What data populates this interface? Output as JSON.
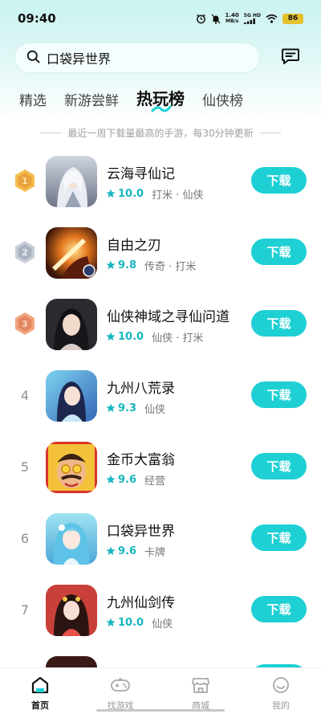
{
  "status_bar": {
    "time": "09:40",
    "net_speed_value": "1.40",
    "net_speed_unit": "MB/s",
    "net_type": "5G HD",
    "battery": "86"
  },
  "search": {
    "query": "口袋异世界"
  },
  "tabs": [
    {
      "label": "精选",
      "active": false
    },
    {
      "label": "新游尝鲜",
      "active": false
    },
    {
      "label": "热玩榜",
      "active": true
    },
    {
      "label": "仙侠榜",
      "active": false
    }
  ],
  "subtitle": "最近一周下载量最高的手游，每30分钟更新",
  "colors": {
    "accent": "#1ed0d4",
    "score": "#19b6bf",
    "gold": "#f0b23c",
    "silver": "#b8bfcc",
    "bronze": "#e8936a"
  },
  "games": [
    {
      "rank": "1",
      "medal": "gold",
      "name": "云海寻仙记",
      "score": "10.0",
      "tags": "打米 · 仙侠",
      "button": "下载"
    },
    {
      "rank": "2",
      "medal": "silver",
      "name": "自由之刃",
      "score": "9.8",
      "tags": "传奇 · 打米",
      "button": "下载"
    },
    {
      "rank": "3",
      "medal": "bronze",
      "name": "仙侠神域之寻仙问道",
      "score": "10.0",
      "tags": "仙侠 · 打米",
      "button": "下载"
    },
    {
      "rank": "4",
      "medal": "",
      "name": "九州八荒录",
      "score": "9.3",
      "tags": "仙侠",
      "button": "下载"
    },
    {
      "rank": "5",
      "medal": "",
      "name": "金币大富翁",
      "score": "9.6",
      "tags": "经营",
      "button": "下载"
    },
    {
      "rank": "6",
      "medal": "",
      "name": "口袋异世界",
      "score": "9.6",
      "tags": "卡牌",
      "button": "下载"
    },
    {
      "rank": "7",
      "medal": "",
      "name": "九州仙剑传",
      "score": "10.0",
      "tags": "仙侠",
      "button": "下载"
    }
  ],
  "bottom_nav": [
    {
      "label": "首页",
      "icon": "home-icon",
      "active": true
    },
    {
      "label": "找游戏",
      "icon": "gamepad-icon",
      "active": false
    },
    {
      "label": "商城",
      "icon": "store-icon",
      "active": false
    },
    {
      "label": "我的",
      "icon": "smile-icon",
      "active": false
    }
  ]
}
